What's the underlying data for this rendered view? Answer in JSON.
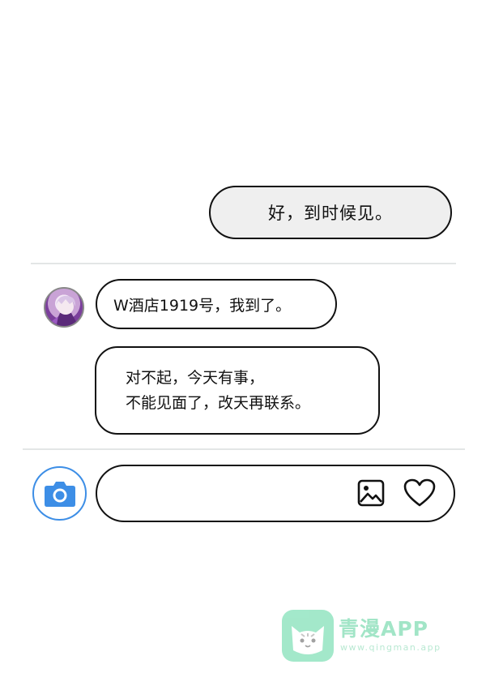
{
  "conversation": {
    "sent": [
      {
        "text": "好，到时候见。"
      }
    ],
    "received": [
      {
        "text": "W酒店1919号，我到了。"
      },
      {
        "lines": [
          "对不起，今天有事，",
          "不能见面了，改天再联系。"
        ]
      }
    ]
  },
  "composer": {
    "camera_icon": "camera-icon",
    "image_icon": "image-icon",
    "like_icon": "heart-icon",
    "accent_color": "#3d8ee6"
  },
  "watermark": {
    "title": "青漫APP",
    "url": "www.qingman.app",
    "color": "#58d7a0"
  }
}
